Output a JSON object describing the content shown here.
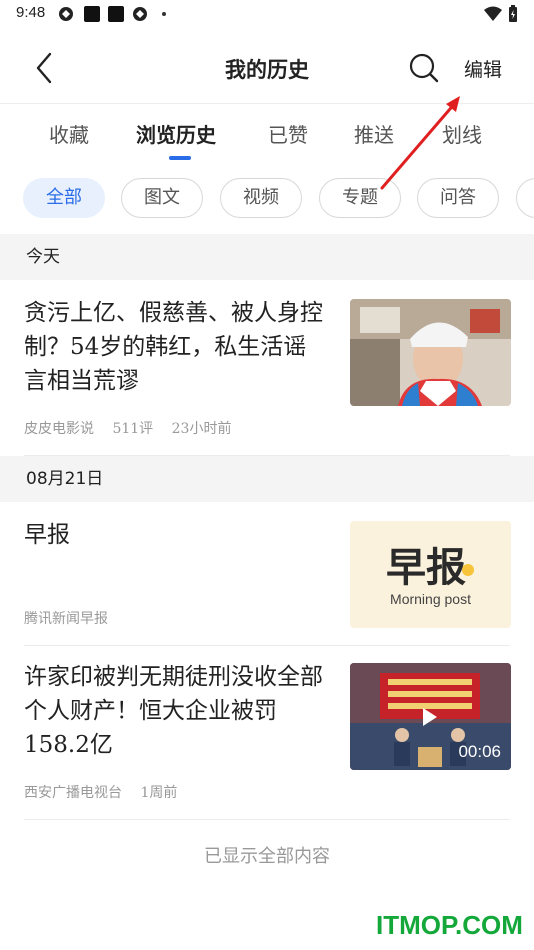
{
  "status": {
    "time": "9:48"
  },
  "header": {
    "title": "我的历史",
    "edit_label": "编辑"
  },
  "tabs": [
    {
      "label": "收藏"
    },
    {
      "label": "浏览历史",
      "active": true
    },
    {
      "label": "已赞"
    },
    {
      "label": "推送"
    },
    {
      "label": "划线"
    }
  ],
  "filters": [
    {
      "label": "全部",
      "active": true
    },
    {
      "label": "图文"
    },
    {
      "label": "视频"
    },
    {
      "label": "专题"
    },
    {
      "label": "问答"
    }
  ],
  "sections": [
    {
      "date": "今天",
      "items": [
        {
          "title": "贪污上亿、假慈善、被人身控制？54岁的韩红，私生活谣言相当荒谬",
          "source": "皮皮电影说",
          "comments": "511评",
          "time": "23小时前"
        }
      ]
    },
    {
      "date": "08月21日",
      "items": [
        {
          "title": "早报",
          "source": "腾讯新闻早报",
          "thumb_title": "早报",
          "thumb_subtitle": "Morning post"
        },
        {
          "title": "许家印被判无期徒刑没收全部个人财产！恒大企业被罚158.2亿",
          "source": "西安广播电视台",
          "time": "1周前",
          "duration": "00:06"
        }
      ]
    }
  ],
  "footer": {
    "end_text": "已显示全部内容"
  },
  "watermark": "ITMOP.COM",
  "colors": {
    "accent": "#2b6de8",
    "chip_active_bg": "#e8f0fd",
    "annotation_arrow": "#e02020",
    "watermark": "#14a83a"
  }
}
